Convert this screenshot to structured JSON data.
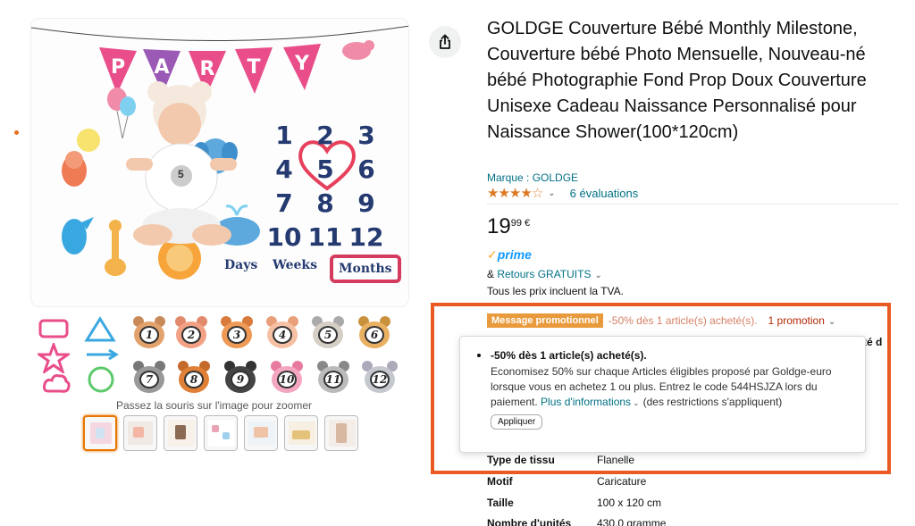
{
  "product": {
    "title": "GOLDGE Couverture Bébé Monthly Milestone, Couverture bébé Photo Mensuelle, Nouveau-né bébé Photographie Fond Prop Doux Couverture Unisexe Cadeau Naissance Personnalisé pour Naissance Shower(100*120cm)",
    "brand_label": "Marque : GOLDGE",
    "rating_stars": 4,
    "rating_count": "6 évaluations",
    "price_whole": "19",
    "price_fraction": "99 €",
    "prime_label": "prime",
    "returns_prefix": "& ",
    "returns_link": "Retours GRATUITS",
    "vat_note": "Tous les prix incluent la TVA."
  },
  "gallery": {
    "zoom_hint": "Passez la souris sur l'image pour zoomer",
    "main_image": {
      "bunting_letters": [
        "P",
        "A",
        "R",
        "T",
        "Y"
      ],
      "numbers": [
        "1",
        "2",
        "3",
        "4",
        "5",
        "6",
        "7",
        "8",
        "9",
        "10",
        "11",
        "12"
      ],
      "words": [
        "Days",
        "Weeks",
        "Months"
      ],
      "belly_number": "5"
    },
    "prop_numbers": [
      "1",
      "2",
      "3",
      "4",
      "5",
      "6",
      "7",
      "8",
      "9",
      "10",
      "11",
      "12"
    ],
    "thumbnail_count": 7,
    "active_thumbnail": 0
  },
  "promo": {
    "badge": "Message promotionnel",
    "summary": "-50% dès 1 article(s) acheté(s).",
    "promotion_link": "1 promotion",
    "popover": {
      "title": "-50% dès 1 article(s) acheté(s).",
      "body": "Economisez 50% sur chaque Articles éligibles proposé par Goldge-euro lorsque vous en achetez 1 ou plus. Entrez le code 544HSJZA lors du paiement.",
      "more_link": "Plus d'informations",
      "restrictions": "(des restrictions s'appliquent)",
      "apply_button": "Appliquer"
    }
  },
  "side_cut_text": "té d",
  "specs": [
    {
      "key": "Type de tissu",
      "value": "Flanelle"
    },
    {
      "key": "Motif",
      "value": "Caricature"
    },
    {
      "key": "Taille",
      "value": "100 x 120 cm"
    },
    {
      "key": "Nombre d'unités",
      "value": "430,0 gramme"
    }
  ],
  "colors": {
    "highlight": "#ea5b24",
    "link": "#007185",
    "star": "#de7921",
    "prime": "#1399ff",
    "promo_badge": "#e89a3c",
    "promo_link": "#b12704"
  },
  "icons": [
    "share-icon",
    "star-icon",
    "chevron-down-icon",
    "prime-check-icon"
  ]
}
